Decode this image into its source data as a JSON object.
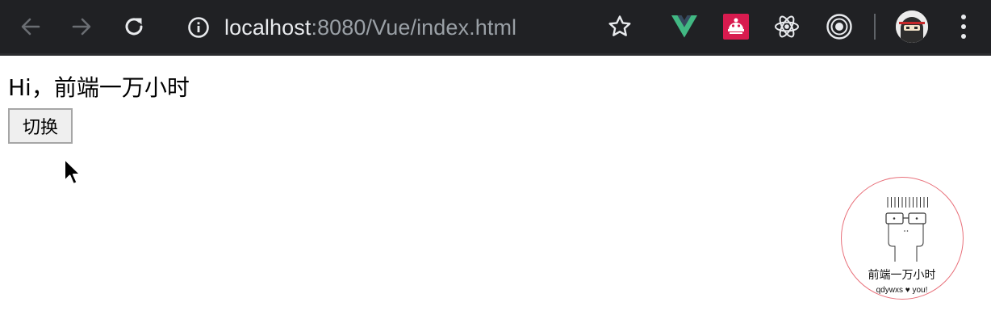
{
  "browser": {
    "url_host": "localhost",
    "url_rest": ":8080/Vue/index.html",
    "toolbar_icons": [
      "back-arrow-icon",
      "forward-arrow-icon",
      "reload-icon",
      "info-icon",
      "bookmark-star-icon"
    ],
    "extension_icons": [
      "vue-devtools-icon",
      "red-extension-icon",
      "react-devtools-icon",
      "target-extension-icon"
    ],
    "profile_icon": "ninja-avatar-icon",
    "menu_icon": "three-dot-menu-icon",
    "colors": {
      "toolbar_bg": "#202124",
      "url_host": "#e8eaed",
      "url_rest": "#9aa0a6",
      "vue_green": "#41b883",
      "vue_dark": "#35495e",
      "red_ext": "#d81b4f"
    }
  },
  "page": {
    "greeting": "Hi，前端一万小时",
    "switch_button_label": "切换"
  },
  "badge": {
    "title": "前端一万小时",
    "subtitle": "qdywxs ♥ you!",
    "border_color": "#e8707a"
  }
}
